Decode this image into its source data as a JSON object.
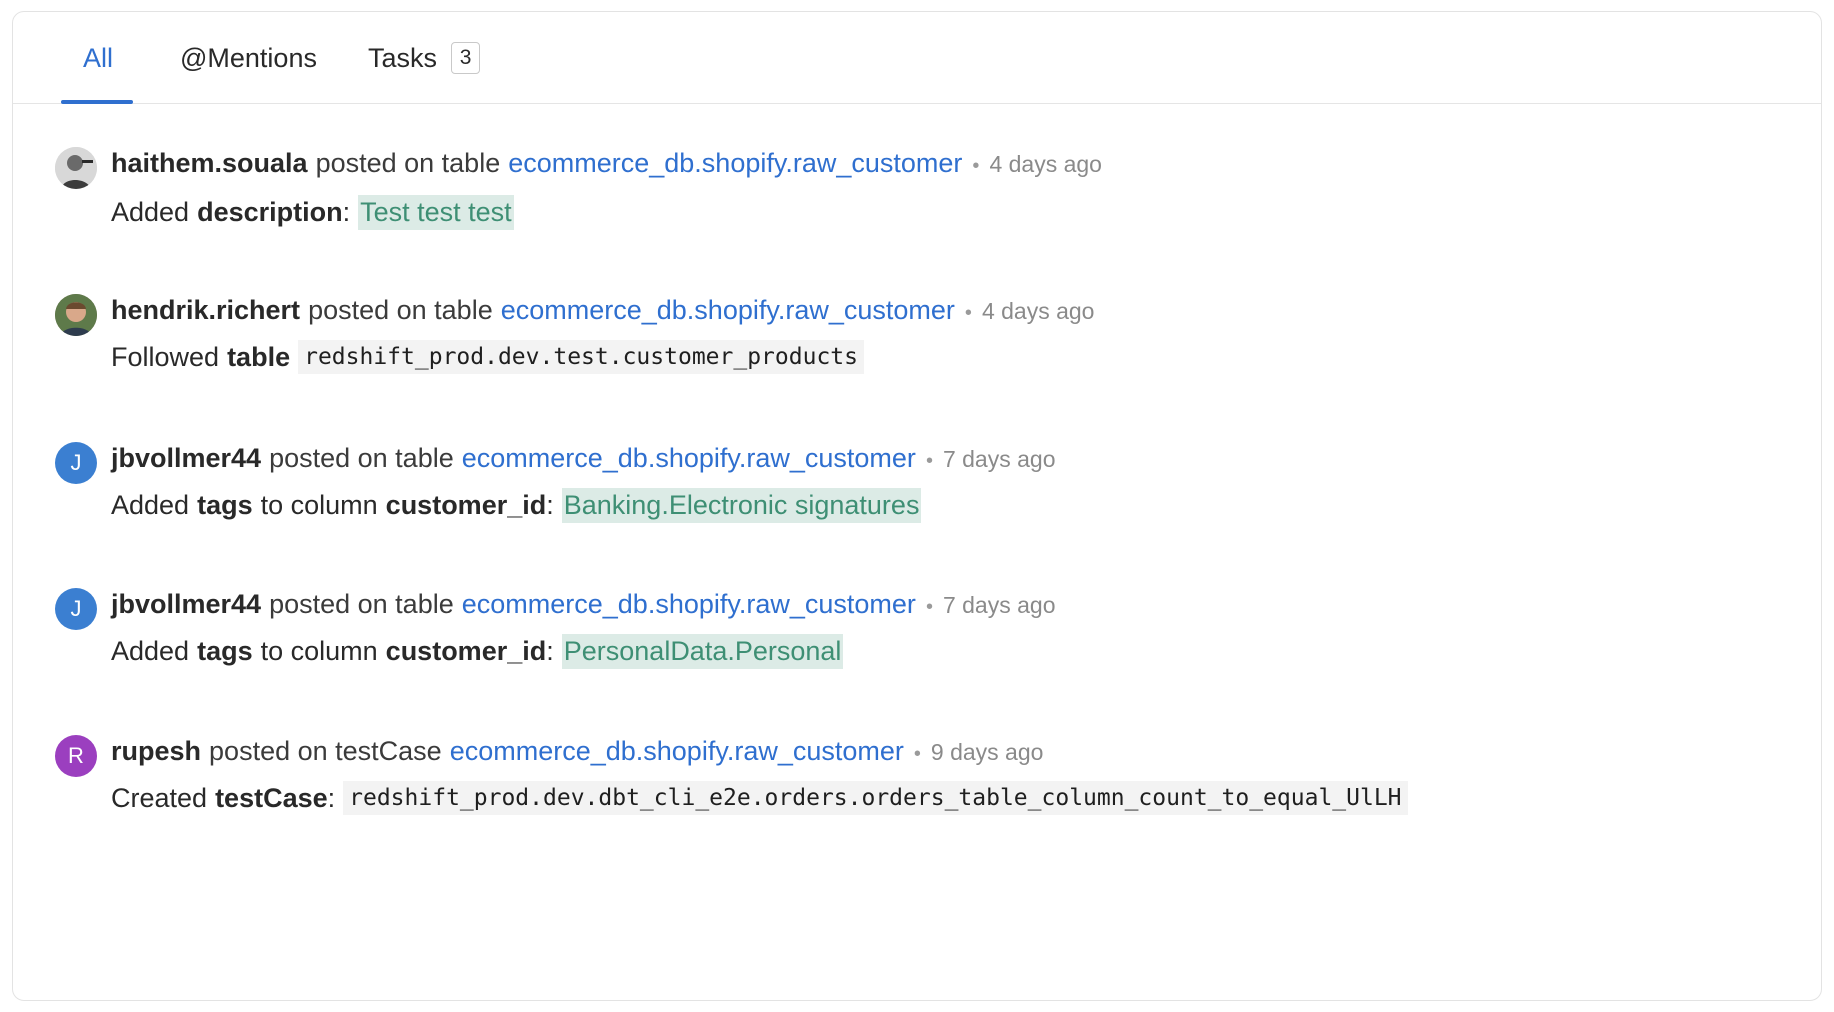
{
  "tabs": {
    "all": "All",
    "mentions": "@Mentions",
    "tasks": "Tasks",
    "tasks_count": "3"
  },
  "colors": {
    "accent": "#2f6fcf",
    "tag_bg": "#dcebe6",
    "tag_text": "#3e8f74",
    "avatar_j": "#3b7fd1",
    "avatar_r": "#9b3fbf"
  },
  "feed": [
    {
      "user": "haithem.souala",
      "action": "posted on table",
      "entity": "ecommerce_db.shopify.raw_customer",
      "time": "4 days ago",
      "detail_prefix": "Added",
      "detail_bold": "description",
      "detail_value": "Test test test",
      "avatar": "photo"
    },
    {
      "user": "hendrik.richert",
      "action": "posted on table",
      "entity": "ecommerce_db.shopify.raw_customer",
      "time": "4 days ago",
      "detail_prefix": "Followed",
      "detail_bold": "table",
      "detail_value": "redshift_prod.dev.test.customer_products",
      "avatar": "photo"
    },
    {
      "user": "jbvollmer44",
      "action": "posted on table",
      "entity": "ecommerce_db.shopify.raw_customer",
      "time": "7 days ago",
      "detail_prefix": "Added",
      "detail_bold": "tags",
      "detail_mid": "to column",
      "detail_bold2": "customer_id",
      "detail_value": "Banking.Electronic signatures",
      "avatar": "J"
    },
    {
      "user": "jbvollmer44",
      "action": "posted on table",
      "entity": "ecommerce_db.shopify.raw_customer",
      "time": "7 days ago",
      "detail_prefix": "Added",
      "detail_bold": "tags",
      "detail_mid": "to column",
      "detail_bold2": "customer_id",
      "detail_value": "PersonalData.Personal",
      "avatar": "J"
    },
    {
      "user": "rupesh",
      "action": "posted on testCase",
      "entity": "ecommerce_db.shopify.raw_customer",
      "time": "9 days ago",
      "detail_prefix": "Created",
      "detail_bold": "testCase",
      "detail_value": "redshift_prod.dev.dbt_cli_e2e.orders.orders_table_column_count_to_equal_UlLH",
      "avatar": "R"
    }
  ],
  "separators": {
    "dot": "•",
    "colon": ":"
  }
}
